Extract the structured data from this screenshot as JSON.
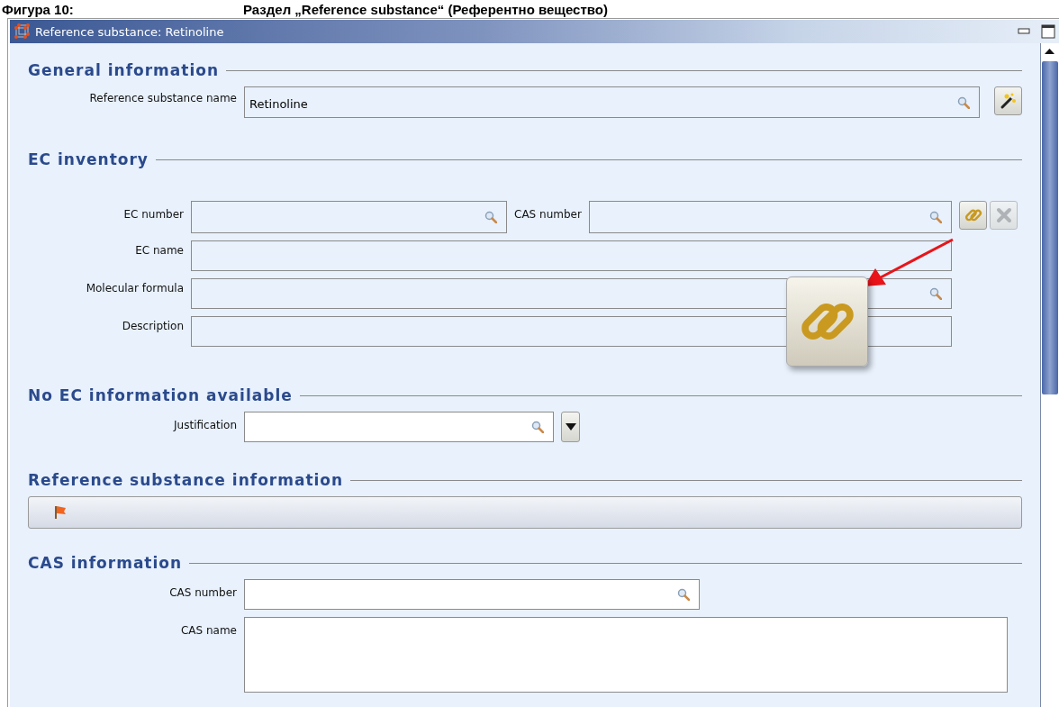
{
  "caption": {
    "figure": "Фигура 10:",
    "title": "Раздел „Reference substance“ (Референтно вещество)"
  },
  "window": {
    "title": "Reference substance: Retinoline"
  },
  "sections": [
    {
      "kind": "form",
      "title": "General information",
      "rows": [
        {
          "kind": "lookup",
          "label": "Reference substance name",
          "value": "Retinoline",
          "searchable": true,
          "editable": false,
          "buttons": [
            {
              "kind": "wand",
              "disabled": false
            }
          ]
        }
      ]
    },
    {
      "kind": "ec",
      "title": "EC inventory",
      "rows": [
        {
          "kind": "pair",
          "fields": [
            {
              "label": "EC number",
              "searchable": true,
              "editable": false
            },
            {
              "label": "CAS number",
              "searchable": true,
              "editable": false
            }
          ],
          "buttons": [
            {
              "kind": "link",
              "disabled": false
            },
            {
              "kind": "delete",
              "disabled": true
            }
          ]
        },
        {
          "kind": "wide",
          "label": "EC name",
          "searchable": false,
          "editable": false
        },
        {
          "kind": "wide",
          "label": "Molecular formula",
          "searchable": true,
          "editable": false
        },
        {
          "kind": "wide",
          "label": "Description",
          "searchable": false,
          "editable": false
        }
      ]
    },
    {
      "kind": "form",
      "title": "No EC information available",
      "rows": [
        {
          "kind": "combo",
          "label": "Justification",
          "searchable": true,
          "editable": true,
          "buttons": [
            {
              "kind": "dropdown",
              "disabled": false
            }
          ]
        }
      ]
    },
    {
      "kind": "bar",
      "title": "Reference substance information"
    },
    {
      "kind": "form",
      "title": "CAS information",
      "rows": [
        {
          "kind": "short",
          "label": "CAS number",
          "searchable": true,
          "editable": true
        },
        {
          "kind": "textarea",
          "label": "CAS name",
          "searchable": false,
          "editable": true
        }
      ]
    }
  ]
}
